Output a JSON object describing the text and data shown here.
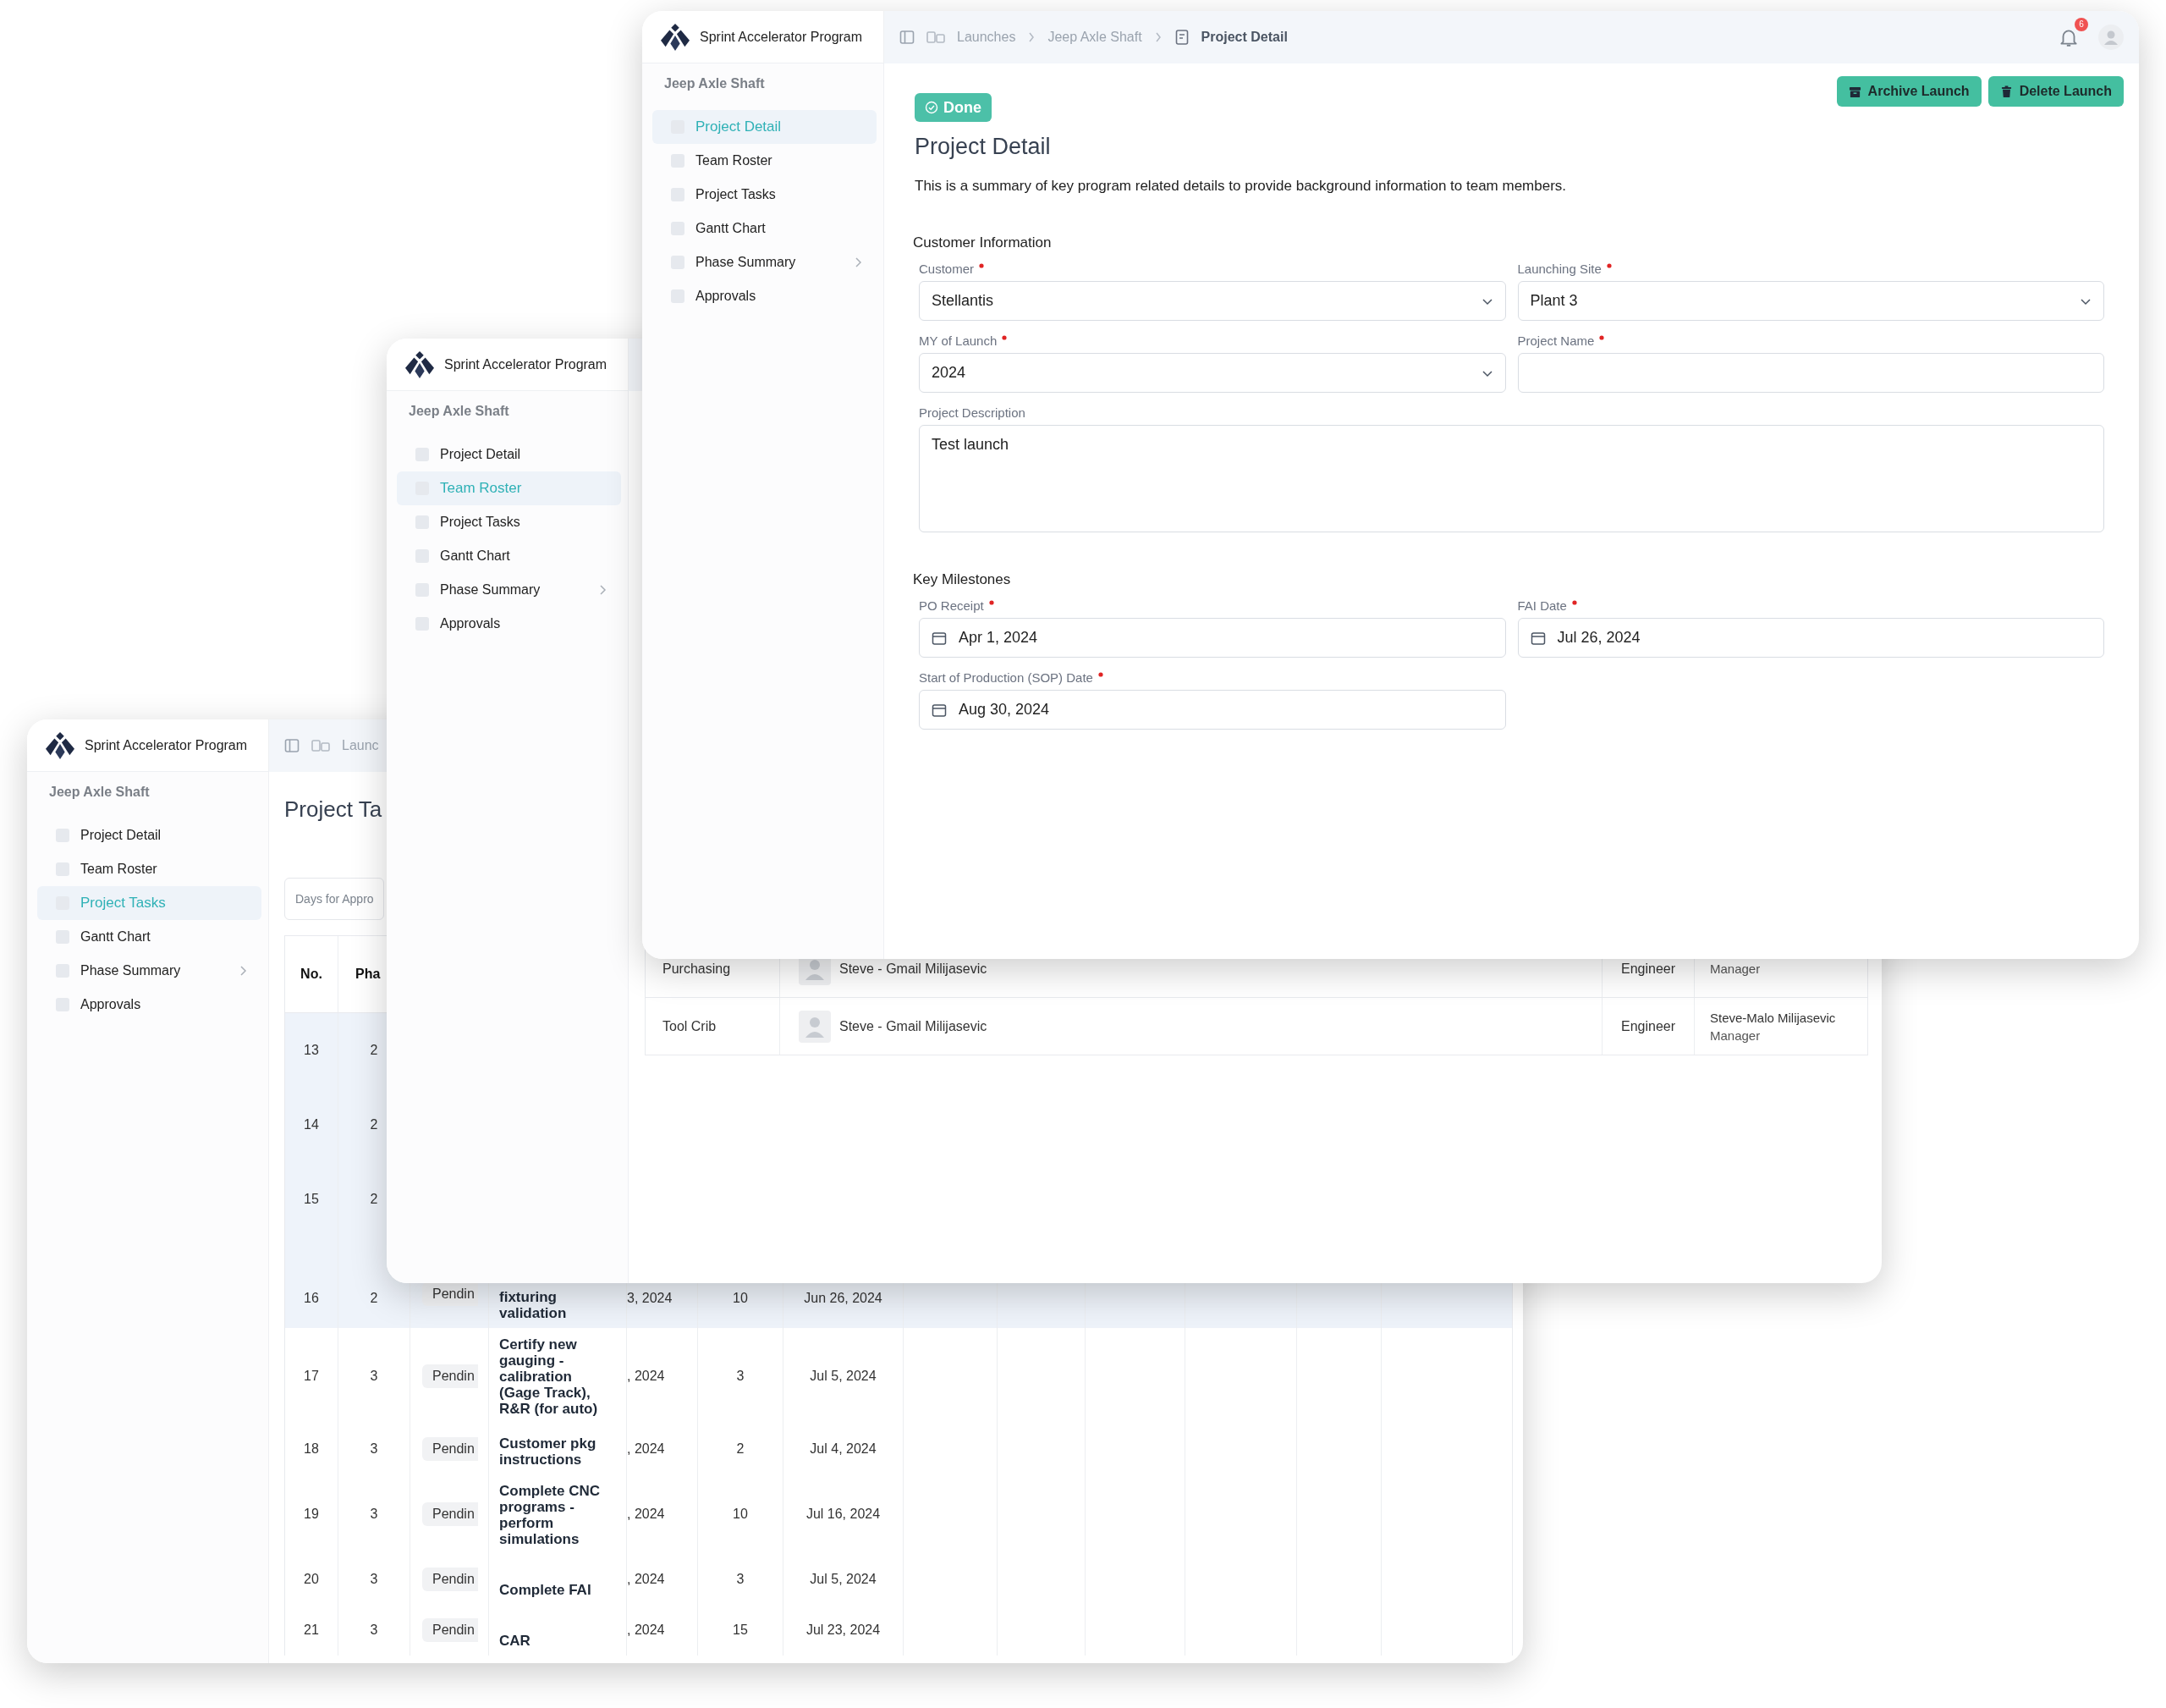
{
  "tasks_window": {
    "app_name": "Sprint Accelerator Program",
    "project": "Jeep Axle Shaft",
    "nav": [
      {
        "label": "Project Detail",
        "selected": false,
        "has_submenu": false
      },
      {
        "label": "Team Roster",
        "selected": false,
        "has_submenu": false
      },
      {
        "label": "Project Tasks",
        "selected": true,
        "has_submenu": false
      },
      {
        "label": "Gantt Chart",
        "selected": false,
        "has_submenu": false
      },
      {
        "label": "Phase Summary",
        "selected": false,
        "has_submenu": true
      },
      {
        "label": "Approvals",
        "selected": false,
        "has_submenu": false
      }
    ],
    "breadcrumb": "Launc",
    "page_title": "Project Ta",
    "filter": {
      "placeholder": "Days for Appro"
    },
    "columns": [
      "No.",
      "Pha"
    ],
    "rows": [
      {
        "no": "13",
        "phase": "2",
        "highlighted": true
      },
      {
        "no": "14",
        "phase": "2",
        "highlighted": true
      },
      {
        "no": "15",
        "phase": "2",
        "highlighted": true
      },
      {
        "no": "16",
        "phase": "2",
        "status": "Pendin",
        "task": "fixturing validation",
        "start": "3, 2024",
        "days": "10",
        "end": "Jun 26, 2024",
        "highlighted": true
      },
      {
        "no": "17",
        "phase": "3",
        "status": "Pendin",
        "task": "Certify new gauging - calibration (Gage Track), R&R (for auto)",
        "start": ", 2024",
        "days": "3",
        "end": "Jul 5, 2024",
        "highlighted": false
      },
      {
        "no": "18",
        "phase": "3",
        "status": "Pendin",
        "task": "Customer pkg instructions",
        "start": ", 2024",
        "days": "2",
        "end": "Jul 4, 2024",
        "highlighted": false
      },
      {
        "no": "19",
        "phase": "3",
        "status": "Pendin",
        "task": "Complete CNC programs - perform simulations",
        "start": ", 2024",
        "days": "10",
        "end": "Jul 16, 2024",
        "highlighted": false
      },
      {
        "no": "20",
        "phase": "3",
        "status": "Pendin",
        "task": "Complete FAI",
        "start": ", 2024",
        "days": "3",
        "end": "Jul 5, 2024",
        "highlighted": false
      },
      {
        "no": "21",
        "phase": "3",
        "status": "Pendin",
        "task": "CAR",
        "start": ", 2024",
        "days": "15",
        "end": "Jul 23, 2024",
        "highlighted": false
      }
    ]
  },
  "roster_window": {
    "app_name": "Sprint Accelerator Program",
    "project": "Jeep Axle Shaft",
    "nav": [
      {
        "label": "Project Detail",
        "selected": false,
        "has_submenu": false
      },
      {
        "label": "Team Roster",
        "selected": true,
        "has_submenu": false
      },
      {
        "label": "Project Tasks",
        "selected": false,
        "has_submenu": false
      },
      {
        "label": "Gantt Chart",
        "selected": false,
        "has_submenu": false
      },
      {
        "label": "Phase Summary",
        "selected": false,
        "has_submenu": true
      },
      {
        "label": "Approvals",
        "selected": false,
        "has_submenu": false
      }
    ],
    "rows": [
      {
        "department": "Purchasing",
        "member": "Steve - Gmail Milijasevic",
        "role": "Engineer",
        "manager_title": "Manager"
      },
      {
        "department": "Tool Crib",
        "member": "Steve - Gmail Milijasevic",
        "role": "Engineer",
        "manager": "Steve-Malo Milijasevic",
        "manager_title": "Manager"
      }
    ]
  },
  "detail_window": {
    "app_name": "Sprint Accelerator Program",
    "project": "Jeep Axle Shaft",
    "nav": [
      {
        "label": "Project Detail",
        "selected": true,
        "has_submenu": false
      },
      {
        "label": "Team Roster",
        "selected": false,
        "has_submenu": false
      },
      {
        "label": "Project Tasks",
        "selected": false,
        "has_submenu": false
      },
      {
        "label": "Gantt Chart",
        "selected": false,
        "has_submenu": false
      },
      {
        "label": "Phase Summary",
        "selected": false,
        "has_submenu": true
      },
      {
        "label": "Approvals",
        "selected": false,
        "has_submenu": false
      }
    ],
    "breadcrumb": [
      {
        "label": "Launches",
        "kind": "launches"
      },
      {
        "label": "Jeep Axle Shaft",
        "kind": "plain"
      },
      {
        "label": "Project Detail",
        "kind": "current"
      }
    ],
    "notification_count": "6",
    "status_badge": "Done",
    "actions": [
      {
        "label": "Archive Launch",
        "kind": "archive"
      },
      {
        "label": "Delete Launch",
        "kind": "delete"
      }
    ],
    "title": "Project Detail",
    "description": "This is a summary of key program related details to provide background information to team members.",
    "sections": [
      {
        "title": "Customer Information",
        "fields": [
          {
            "label": "Customer",
            "required": true,
            "kind": "select",
            "value": "Stellantis"
          },
          {
            "label": "Launching Site",
            "required": true,
            "kind": "select",
            "value": "Plant 3"
          },
          {
            "label": "MY of Launch",
            "required": true,
            "kind": "select",
            "value": "2024"
          },
          {
            "label": "Project Name",
            "required": true,
            "kind": "text"
          },
          {
            "label": "Project Description",
            "required": false,
            "kind": "textarea",
            "value": "Test launch"
          }
        ]
      },
      {
        "title": "Key Milestones",
        "fields": [
          {
            "label": "PO Receipt",
            "required": true,
            "kind": "date",
            "value": "Apr 1, 2024"
          },
          {
            "label": "FAI Date",
            "required": true,
            "kind": "date",
            "value": "Jul 26, 2024"
          },
          {
            "label": "Start of Production (SOP) Date",
            "required": true,
            "kind": "date",
            "value": "Aug 30, 2024"
          }
        ]
      }
    ]
  }
}
